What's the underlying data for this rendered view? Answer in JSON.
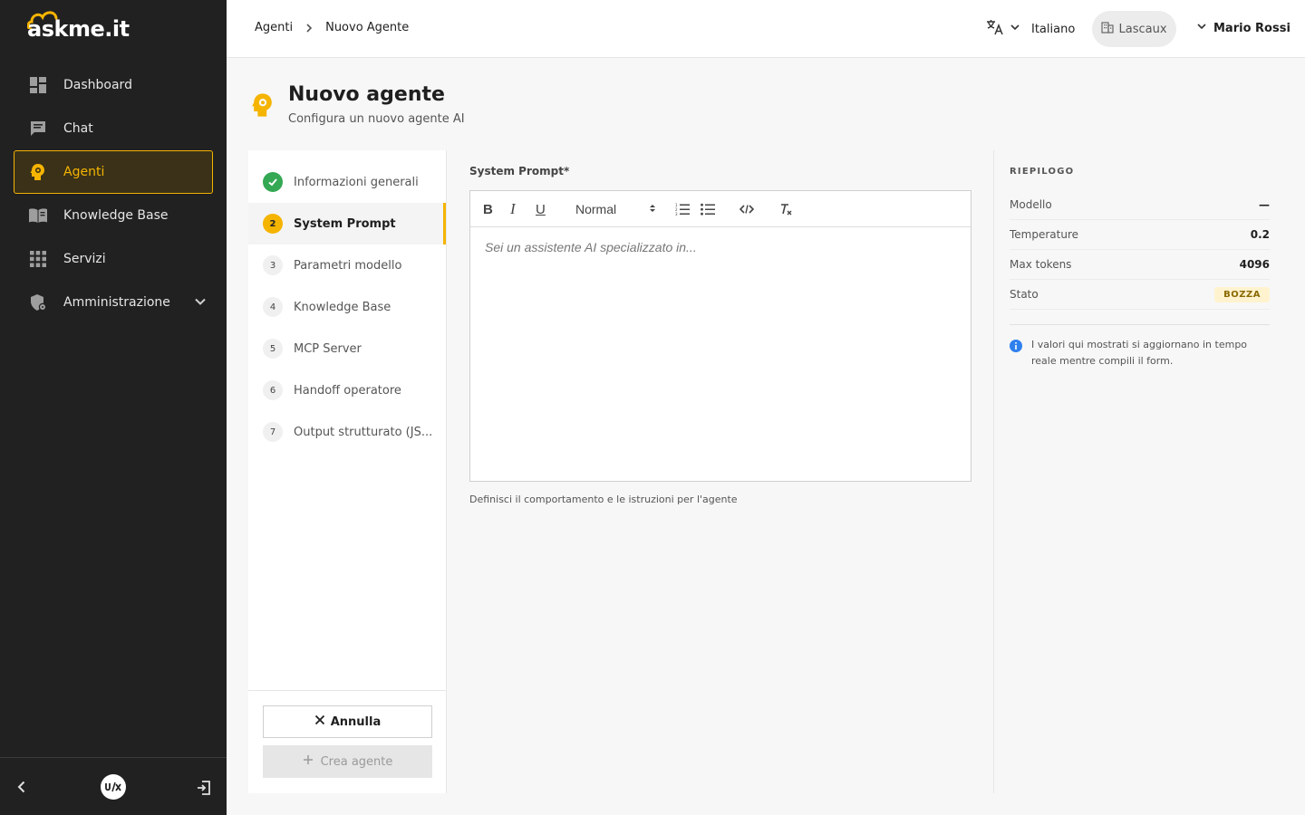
{
  "app": {
    "logo_text": "askme.it"
  },
  "sidebar": {
    "items": [
      {
        "label": "Dashboard",
        "icon": "dashboard-icon"
      },
      {
        "label": "Chat",
        "icon": "chat-icon"
      },
      {
        "label": "Agenti",
        "icon": "agent-icon",
        "active": true
      },
      {
        "label": "Knowledge Base",
        "icon": "book-icon"
      },
      {
        "label": "Servizi",
        "icon": "grid-icon"
      },
      {
        "label": "Amministrazione",
        "icon": "shield-icon",
        "expandable": true
      }
    ]
  },
  "breadcrumb": {
    "parent": "Agenti",
    "current": "Nuovo Agente"
  },
  "header": {
    "language": "Italiano",
    "tenant": "Lascaux",
    "user": "Mario Rossi"
  },
  "page": {
    "title": "Nuovo agente",
    "subtitle": "Configura un nuovo agente AI"
  },
  "steps": [
    {
      "num": "1",
      "label": "Informazioni generali",
      "state": "done"
    },
    {
      "num": "2",
      "label": "System Prompt",
      "state": "active"
    },
    {
      "num": "3",
      "label": "Parametri modello",
      "state": "todo"
    },
    {
      "num": "4",
      "label": "Knowledge Base",
      "state": "todo"
    },
    {
      "num": "5",
      "label": "MCP Server",
      "state": "todo"
    },
    {
      "num": "6",
      "label": "Handoff operatore",
      "state": "todo"
    },
    {
      "num": "7",
      "label": "Output strutturato (JS...",
      "state": "todo"
    }
  ],
  "actions": {
    "cancel": "Annulla",
    "create": "Crea agente"
  },
  "editor": {
    "label": "System Prompt*",
    "format": "Normal",
    "placeholder": "Sei un assistente AI specializzato in...",
    "helper": "Definisci il comportamento e le istruzioni per l'agente"
  },
  "summary": {
    "title": "RIEPILOGO",
    "rows": [
      {
        "label": "Modello",
        "value": "—"
      },
      {
        "label": "Temperature",
        "value": "0.2"
      },
      {
        "label": "Max tokens",
        "value": "4096"
      },
      {
        "label": "Stato",
        "value": "BOZZA"
      }
    ],
    "info": "I valori qui mostrati si aggiornano in tempo reale mentre compili il form."
  },
  "colors": {
    "accent": "#f5b400",
    "sidebar_bg": "#212121",
    "success": "#34a853"
  }
}
